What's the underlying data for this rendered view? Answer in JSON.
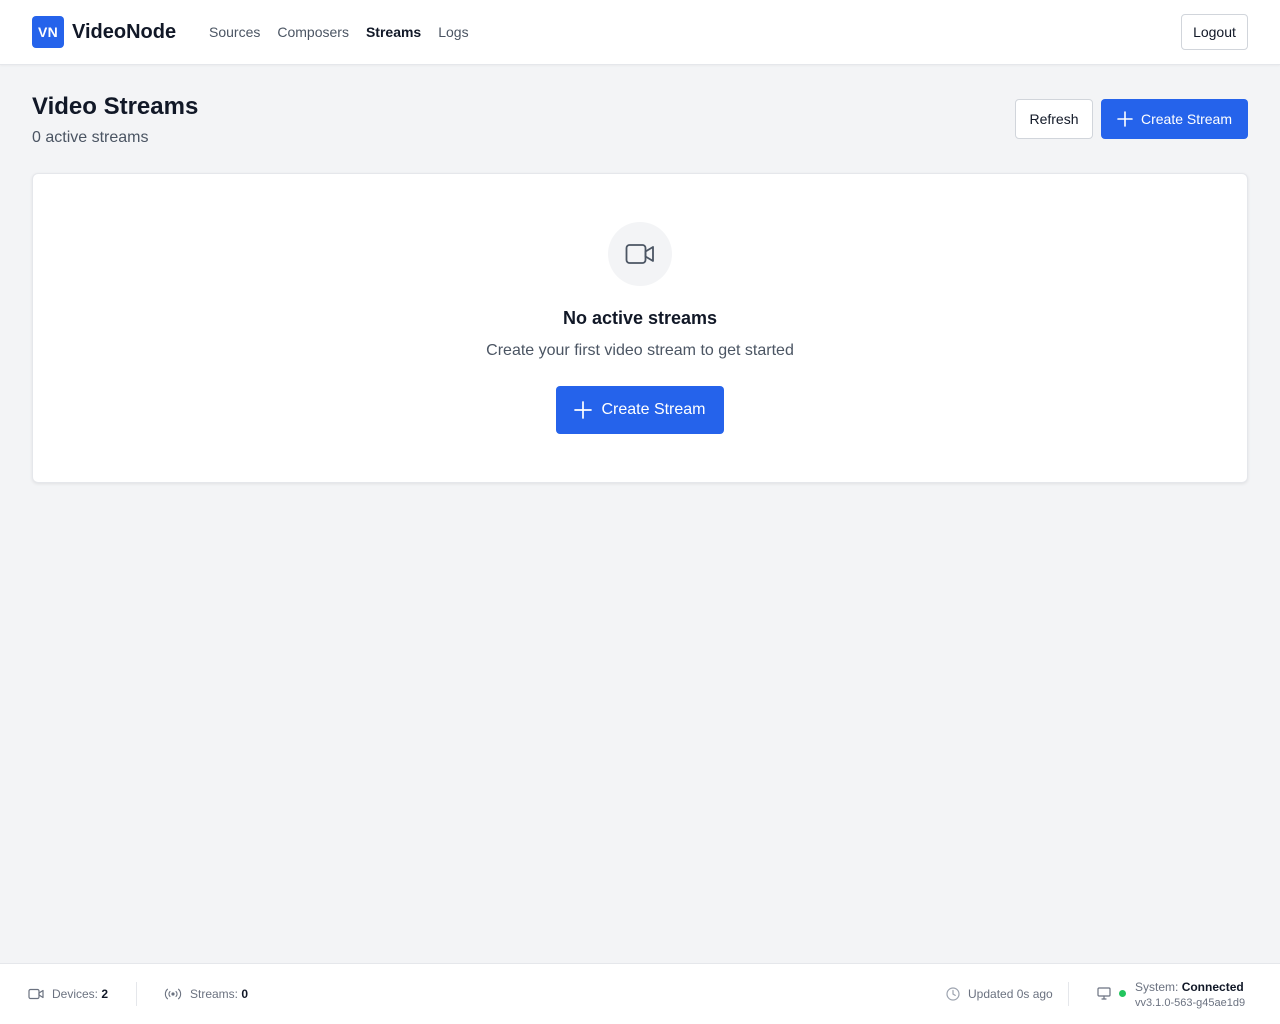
{
  "header": {
    "logo_badge": "VN",
    "app_name": "VideoNode",
    "nav": [
      {
        "label": "Sources"
      },
      {
        "label": "Composers"
      },
      {
        "label": "Streams",
        "active": true
      },
      {
        "label": "Logs"
      }
    ],
    "logout_label": "Logout"
  },
  "page": {
    "title": "Video Streams",
    "subtitle": "0 active streams",
    "refresh_label": "Refresh",
    "create_label": "Create Stream"
  },
  "empty_state": {
    "icon": "video-camera-icon",
    "title": "No active streams",
    "description": "Create your first video stream to get started",
    "button_label": "Create Stream"
  },
  "footer": {
    "devices_label": "Devices:",
    "devices_value": "2",
    "streams_label": "Streams:",
    "streams_value": "0",
    "updated_text": "Updated 0s ago",
    "system_label": "System:",
    "system_value": "Connected",
    "version": "vv3.1.0-563-g45ae1d9"
  },
  "colors": {
    "accent": "#2563eb",
    "background": "#f3f4f6",
    "status_ok": "#22c55e"
  }
}
